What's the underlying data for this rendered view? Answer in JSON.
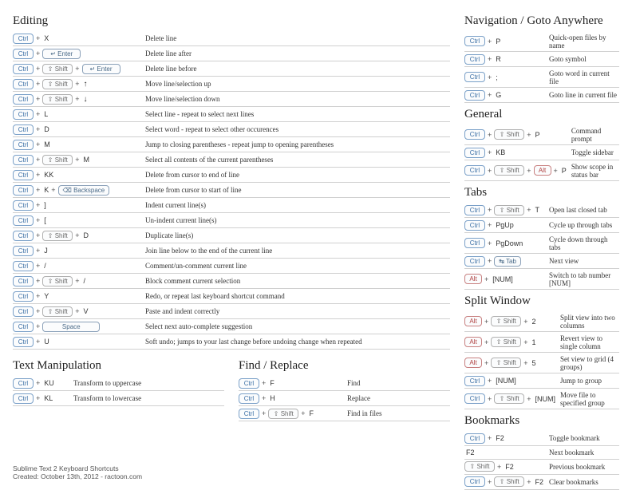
{
  "sections": {
    "editing": {
      "title": "Editing",
      "rows": [
        {
          "keys": [
            {
              "t": "ctrl"
            },
            {
              "t": "plus"
            },
            {
              "t": "plain",
              "v": "X"
            }
          ],
          "desc": "Delete line"
        },
        {
          "keys": [
            {
              "t": "ctrl"
            },
            {
              "t": "plus"
            },
            {
              "t": "key",
              "cls": "med",
              "v": "↵ Enter"
            }
          ],
          "desc": "Delete line after"
        },
        {
          "keys": [
            {
              "t": "ctrl"
            },
            {
              "t": "plus"
            },
            {
              "t": "shift"
            },
            {
              "t": "plus"
            },
            {
              "t": "key",
              "cls": "med",
              "v": "↵ Enter"
            }
          ],
          "desc": "Delete line before"
        },
        {
          "keys": [
            {
              "t": "ctrl"
            },
            {
              "t": "plus"
            },
            {
              "t": "shift"
            },
            {
              "t": "plus"
            },
            {
              "t": "glyph",
              "v": "↑"
            }
          ],
          "desc": "Move line/selection up"
        },
        {
          "keys": [
            {
              "t": "ctrl"
            },
            {
              "t": "plus"
            },
            {
              "t": "shift"
            },
            {
              "t": "plus"
            },
            {
              "t": "glyph",
              "v": "↓"
            }
          ],
          "desc": "Move line/selection down"
        },
        {
          "keys": [
            {
              "t": "ctrl"
            },
            {
              "t": "plus"
            },
            {
              "t": "plain",
              "v": "L"
            }
          ],
          "desc": "Select line - repeat to select next lines"
        },
        {
          "keys": [
            {
              "t": "ctrl"
            },
            {
              "t": "plus"
            },
            {
              "t": "plain",
              "v": "D"
            }
          ],
          "desc": "Select word - repeat to select other occurences"
        },
        {
          "keys": [
            {
              "t": "ctrl"
            },
            {
              "t": "plus"
            },
            {
              "t": "plain",
              "v": "M"
            }
          ],
          "desc": "Jump to closing parentheses - repeat jump to opening parentheses"
        },
        {
          "keys": [
            {
              "t": "ctrl"
            },
            {
              "t": "plus"
            },
            {
              "t": "shift"
            },
            {
              "t": "plus"
            },
            {
              "t": "plain",
              "v": "M"
            }
          ],
          "desc": "Select all contents of the current parentheses"
        },
        {
          "keys": [
            {
              "t": "ctrl"
            },
            {
              "t": "plus"
            },
            {
              "t": "plain",
              "v": "KK"
            }
          ],
          "desc": "Delete from cursor to end of line"
        },
        {
          "keys": [
            {
              "t": "ctrl"
            },
            {
              "t": "plus"
            },
            {
              "t": "plain",
              "v": "K"
            },
            {
              "t": "plus"
            },
            {
              "t": "key",
              "cls": "med",
              "v": "⌫ Backspace"
            }
          ],
          "desc": "Delete from cursor to start of line"
        },
        {
          "keys": [
            {
              "t": "ctrl"
            },
            {
              "t": "plus"
            },
            {
              "t": "plain",
              "v": "]"
            }
          ],
          "desc": "Indent current line(s)"
        },
        {
          "keys": [
            {
              "t": "ctrl"
            },
            {
              "t": "plus"
            },
            {
              "t": "plain",
              "v": "["
            }
          ],
          "desc": "Un-indent current line(s)"
        },
        {
          "keys": [
            {
              "t": "ctrl"
            },
            {
              "t": "plus"
            },
            {
              "t": "shift"
            },
            {
              "t": "plus"
            },
            {
              "t": "plain",
              "v": "D"
            }
          ],
          "desc": "Duplicate line(s)"
        },
        {
          "keys": [
            {
              "t": "ctrl"
            },
            {
              "t": "plus"
            },
            {
              "t": "plain",
              "v": "J"
            }
          ],
          "desc": "Join line below to the end of the current line"
        },
        {
          "keys": [
            {
              "t": "ctrl"
            },
            {
              "t": "plus"
            },
            {
              "t": "plain",
              "v": "/"
            }
          ],
          "desc": "Comment/un-comment current line"
        },
        {
          "keys": [
            {
              "t": "ctrl"
            },
            {
              "t": "plus"
            },
            {
              "t": "shift"
            },
            {
              "t": "plus"
            },
            {
              "t": "plain",
              "v": "/"
            }
          ],
          "desc": "Block comment current selection"
        },
        {
          "keys": [
            {
              "t": "ctrl"
            },
            {
              "t": "plus"
            },
            {
              "t": "plain",
              "v": "Y"
            }
          ],
          "desc": "Redo, or repeat last keyboard shortcut command"
        },
        {
          "keys": [
            {
              "t": "ctrl"
            },
            {
              "t": "plus"
            },
            {
              "t": "shift"
            },
            {
              "t": "plus"
            },
            {
              "t": "plain",
              "v": "V"
            }
          ],
          "desc": "Paste and indent correctly"
        },
        {
          "keys": [
            {
              "t": "ctrl"
            },
            {
              "t": "plus"
            },
            {
              "t": "key",
              "cls": "wide",
              "v": "Space"
            }
          ],
          "desc": "Select next auto-complete suggestion"
        },
        {
          "keys": [
            {
              "t": "ctrl"
            },
            {
              "t": "plus"
            },
            {
              "t": "plain",
              "v": "U"
            }
          ],
          "desc": "Soft undo; jumps to your last change before undoing change when repeated"
        }
      ]
    },
    "textmanip": {
      "title": "Text Manipulation",
      "rows": [
        {
          "keys": [
            {
              "t": "ctrl"
            },
            {
              "t": "plus"
            },
            {
              "t": "plain",
              "v": "KU"
            }
          ],
          "desc": "Transform to uppercase"
        },
        {
          "keys": [
            {
              "t": "ctrl"
            },
            {
              "t": "plus"
            },
            {
              "t": "plain",
              "v": "KL"
            }
          ],
          "desc": "Transform to lowercase"
        }
      ]
    },
    "findreplace": {
      "title": "Find / Replace",
      "rows": [
        {
          "keys": [
            {
              "t": "ctrl"
            },
            {
              "t": "plus"
            },
            {
              "t": "plain",
              "v": "F"
            }
          ],
          "desc": "Find"
        },
        {
          "keys": [
            {
              "t": "ctrl"
            },
            {
              "t": "plus"
            },
            {
              "t": "plain",
              "v": "H"
            }
          ],
          "desc": "Replace"
        },
        {
          "keys": [
            {
              "t": "ctrl"
            },
            {
              "t": "plus"
            },
            {
              "t": "shift"
            },
            {
              "t": "plus"
            },
            {
              "t": "plain",
              "v": "F"
            }
          ],
          "desc": "Find in files"
        }
      ]
    },
    "nav": {
      "title": "Navigation / Goto Anywhere",
      "rows": [
        {
          "keys": [
            {
              "t": "ctrl"
            },
            {
              "t": "plus"
            },
            {
              "t": "plain",
              "v": "P"
            }
          ],
          "desc": "Quick-open files by name"
        },
        {
          "keys": [
            {
              "t": "ctrl"
            },
            {
              "t": "plus"
            },
            {
              "t": "plain",
              "v": "R"
            }
          ],
          "desc": "Goto symbol"
        },
        {
          "keys": [
            {
              "t": "ctrl"
            },
            {
              "t": "plus"
            },
            {
              "t": "plain",
              "v": ";"
            }
          ],
          "desc": "Goto word in current file"
        },
        {
          "keys": [
            {
              "t": "ctrl"
            },
            {
              "t": "plus"
            },
            {
              "t": "plain",
              "v": "G"
            }
          ],
          "desc": "Goto line in current file"
        }
      ]
    },
    "general": {
      "title": "General",
      "rows": [
        {
          "keys": [
            {
              "t": "ctrl"
            },
            {
              "t": "plus"
            },
            {
              "t": "shift"
            },
            {
              "t": "plus"
            },
            {
              "t": "plain",
              "v": "P"
            }
          ],
          "desc": "Command prompt"
        },
        {
          "keys": [
            {
              "t": "ctrl"
            },
            {
              "t": "plus"
            },
            {
              "t": "plain",
              "v": "KB"
            }
          ],
          "desc": "Toggle sidebar"
        },
        {
          "keys": [
            {
              "t": "ctrl"
            },
            {
              "t": "plus"
            },
            {
              "t": "shift"
            },
            {
              "t": "plus"
            },
            {
              "t": "alt"
            },
            {
              "t": "plus"
            },
            {
              "t": "plain",
              "v": "P"
            }
          ],
          "desc": "Show scope in status bar"
        }
      ]
    },
    "tabs": {
      "title": "Tabs",
      "rows": [
        {
          "keys": [
            {
              "t": "ctrl"
            },
            {
              "t": "plus"
            },
            {
              "t": "shift"
            },
            {
              "t": "plus"
            },
            {
              "t": "plain",
              "v": "T"
            }
          ],
          "desc": "Open last closed tab"
        },
        {
          "keys": [
            {
              "t": "ctrl"
            },
            {
              "t": "plus"
            },
            {
              "t": "plain",
              "v": "PgUp"
            }
          ],
          "desc": "Cycle up through tabs"
        },
        {
          "keys": [
            {
              "t": "ctrl"
            },
            {
              "t": "plus"
            },
            {
              "t": "plain",
              "v": "PgDown"
            }
          ],
          "desc": "Cycle down through tabs"
        },
        {
          "keys": [
            {
              "t": "ctrl"
            },
            {
              "t": "plus"
            },
            {
              "t": "key",
              "cls": "",
              "v": "↹ Tab"
            }
          ],
          "desc": "Next view"
        },
        {
          "keys": [
            {
              "t": "alt"
            },
            {
              "t": "plus"
            },
            {
              "t": "plain",
              "v": "[NUM]"
            }
          ],
          "desc": "Switch to tab number [NUM]"
        }
      ]
    },
    "split": {
      "title": "Split Window",
      "rows": [
        {
          "keys": [
            {
              "t": "alt"
            },
            {
              "t": "plus"
            },
            {
              "t": "shift"
            },
            {
              "t": "plus"
            },
            {
              "t": "plain",
              "v": "2"
            }
          ],
          "desc": "Split view into two columns"
        },
        {
          "keys": [
            {
              "t": "alt"
            },
            {
              "t": "plus"
            },
            {
              "t": "shift"
            },
            {
              "t": "plus"
            },
            {
              "t": "plain",
              "v": "1"
            }
          ],
          "desc": "Revert view to single column"
        },
        {
          "keys": [
            {
              "t": "alt"
            },
            {
              "t": "plus"
            },
            {
              "t": "shift"
            },
            {
              "t": "plus"
            },
            {
              "t": "plain",
              "v": "5"
            }
          ],
          "desc": "Set view to grid (4 groups)"
        },
        {
          "keys": [
            {
              "t": "ctrl"
            },
            {
              "t": "plus"
            },
            {
              "t": "plain",
              "v": "[NUM]"
            }
          ],
          "desc": "Jump to group"
        },
        {
          "keys": [
            {
              "t": "ctrl"
            },
            {
              "t": "plus"
            },
            {
              "t": "shift"
            },
            {
              "t": "plus"
            },
            {
              "t": "plain",
              "v": "[NUM]"
            }
          ],
          "desc": "Move file to specified group"
        }
      ]
    },
    "bookmarks": {
      "title": "Bookmarks",
      "rows": [
        {
          "keys": [
            {
              "t": "ctrl"
            },
            {
              "t": "plus"
            },
            {
              "t": "plain",
              "v": "F2"
            }
          ],
          "desc": "Toggle bookmark"
        },
        {
          "keys": [
            {
              "t": "plain",
              "v": "F2"
            }
          ],
          "desc": "Next bookmark"
        },
        {
          "keys": [
            {
              "t": "shift"
            },
            {
              "t": "plus"
            },
            {
              "t": "plain",
              "v": "F2"
            }
          ],
          "desc": "Previous bookmark"
        },
        {
          "keys": [
            {
              "t": "ctrl"
            },
            {
              "t": "plus"
            },
            {
              "t": "shift"
            },
            {
              "t": "plus"
            },
            {
              "t": "plain",
              "v": "F2"
            }
          ],
          "desc": "Clear bookmarks"
        }
      ]
    }
  },
  "labels": {
    "ctrl": "Ctrl",
    "shift": "⇧ Shift",
    "alt": "Alt"
  },
  "footer": {
    "line1": "Sublime Text 2 Keyboard Shortcuts",
    "line2": "Created: October 13th, 2012 - ractoon.com"
  },
  "layout": {
    "editing_keycol": "160px",
    "right_keycol": "100px",
    "find_keycol": "130px",
    "textmanip_keycol": "70px"
  }
}
